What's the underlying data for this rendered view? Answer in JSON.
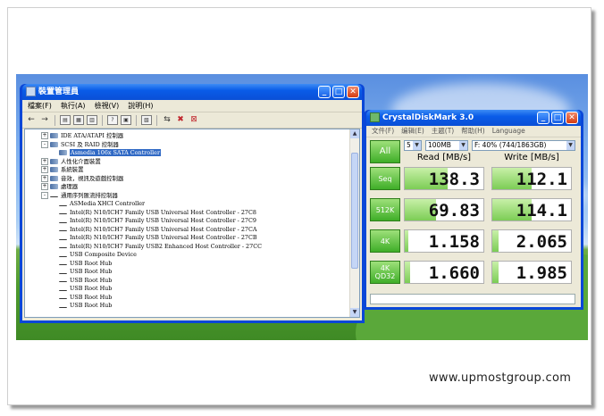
{
  "device_manager": {
    "title": "裝置管理員",
    "menu": [
      "檔案(F)",
      "執行(A)",
      "檢視(V)",
      "說明(H)"
    ],
    "tree": [
      {
        "label": "IDE ATA/ATAPI 控制器",
        "indent": 1,
        "expander": "+",
        "icon": "controller-icon"
      },
      {
        "label": "SCSI 及 RAID 控制器",
        "indent": 1,
        "expander": "-",
        "icon": "controller-icon"
      },
      {
        "label": "Asmedia 106x SATA Controller",
        "indent": 2,
        "expander": "",
        "icon": "controller-icon",
        "selected": true
      },
      {
        "label": "人性化介面裝置",
        "indent": 1,
        "expander": "+",
        "icon": "hid-icon"
      },
      {
        "label": "系統裝置",
        "indent": 1,
        "expander": "+",
        "icon": "system-icon"
      },
      {
        "label": "音效，視訊及遊戲控制器",
        "indent": 1,
        "expander": "+",
        "icon": "sound-icon"
      },
      {
        "label": "處理器",
        "indent": 1,
        "expander": "+",
        "icon": "processor-icon"
      },
      {
        "label": "通用序列匯流排控制器",
        "indent": 1,
        "expander": "-",
        "icon": "usb-icon"
      },
      {
        "label": "ASMedia XHCI Controller",
        "indent": 2,
        "expander": "",
        "icon": "usb-icon"
      },
      {
        "label": "Intel(R) N10/ICH7 Family USB Universal Host Controller - 27C8",
        "indent": 2,
        "expander": "",
        "icon": "usb-icon"
      },
      {
        "label": "Intel(R) N10/ICH7 Family USB Universal Host Controller - 27C9",
        "indent": 2,
        "expander": "",
        "icon": "usb-icon"
      },
      {
        "label": "Intel(R) N10/ICH7 Family USB Universal Host Controller - 27CA",
        "indent": 2,
        "expander": "",
        "icon": "usb-icon"
      },
      {
        "label": "Intel(R) N10/ICH7 Family USB Universal Host Controller - 27CB",
        "indent": 2,
        "expander": "",
        "icon": "usb-icon"
      },
      {
        "label": "Intel(R) N10/ICH7 Family USB2 Enhanced Host Controller - 27CC",
        "indent": 2,
        "expander": "",
        "icon": "usb-icon"
      },
      {
        "label": "USB Composite Device",
        "indent": 2,
        "expander": "",
        "icon": "usb-icon"
      },
      {
        "label": "USB Root Hub",
        "indent": 2,
        "expander": "",
        "icon": "usb-icon"
      },
      {
        "label": "USB Root Hub",
        "indent": 2,
        "expander": "",
        "icon": "usb-icon"
      },
      {
        "label": "USB Root Hub",
        "indent": 2,
        "expander": "",
        "icon": "usb-icon"
      },
      {
        "label": "USB Root Hub",
        "indent": 2,
        "expander": "",
        "icon": "usb-icon"
      },
      {
        "label": "USB Root Hub",
        "indent": 2,
        "expander": "",
        "icon": "usb-icon"
      },
      {
        "label": "USB Root Hub",
        "indent": 2,
        "expander": "",
        "icon": "usb-icon"
      }
    ]
  },
  "cdm": {
    "title": "CrystalDiskMark 3.0",
    "menu": [
      "文件(F)",
      "编辑(E)",
      "主题(T)",
      "帮助(H)",
      "Language"
    ],
    "all_label": "All",
    "count": "5",
    "size": "100MB",
    "drive": "F: 40% (744/1863GB)",
    "read_header": "Read [MB/s]",
    "write_header": "Write [MB/s]",
    "rows": [
      {
        "label": "Seq",
        "read": "138.3",
        "write": "112.1",
        "read_level": 0.55,
        "write_level": 0.5
      },
      {
        "label": "512K",
        "read": "69.83",
        "write": "114.1",
        "read_level": 0.4,
        "write_level": 0.5
      },
      {
        "label": "4K",
        "read": "1.158",
        "write": "2.065",
        "read_level": 0.05,
        "write_level": 0.08
      },
      {
        "label": "4K\nQD32",
        "read": "1.660",
        "write": "1.985",
        "read_level": 0.07,
        "write_level": 0.08
      }
    ]
  },
  "watermark": "www.upmostgroup.com",
  "colors": {
    "xp_blue": "#0a5ce8",
    "cdm_green": "#3fae28",
    "selection": "#316ac5"
  }
}
